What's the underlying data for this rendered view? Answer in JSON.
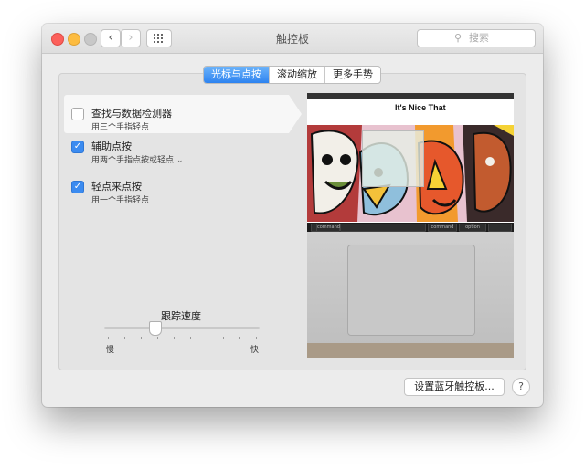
{
  "window": {
    "title": "触控板"
  },
  "toolbar": {
    "back_glyph": "‹",
    "forward_glyph": "›",
    "search_placeholder": "搜索"
  },
  "tabs": [
    {
      "label": "光标与点按",
      "active": true
    },
    {
      "label": "滚动缩放",
      "active": false
    },
    {
      "label": "更多手势",
      "active": false
    }
  ],
  "options": [
    {
      "title": "查找与数据检测器",
      "subtitle": "用三个手指轻点",
      "checked": false
    },
    {
      "title": "辅助点按",
      "subtitle": "用两个手指点按或轻点",
      "checked": true
    },
    {
      "title": "轻点来点按",
      "subtitle": "用一个手指轻点",
      "checked": true
    }
  ],
  "tracking": {
    "title": "跟踪速度",
    "min_label": "慢",
    "max_label": "快",
    "value_fraction": 0.33
  },
  "preview": {
    "site_title": "It's Nice That",
    "keys": [
      "command",
      "command",
      "option"
    ]
  },
  "footer": {
    "bluetooth_button": "设置蓝牙触控板...",
    "help_glyph": "?"
  },
  "colors": {
    "accent": "#2d83f0",
    "checkbox_on": "#3b8bf0"
  },
  "icons": [
    "search-icon",
    "chevron-down-icon",
    "grid-icon",
    "help-icon"
  ]
}
